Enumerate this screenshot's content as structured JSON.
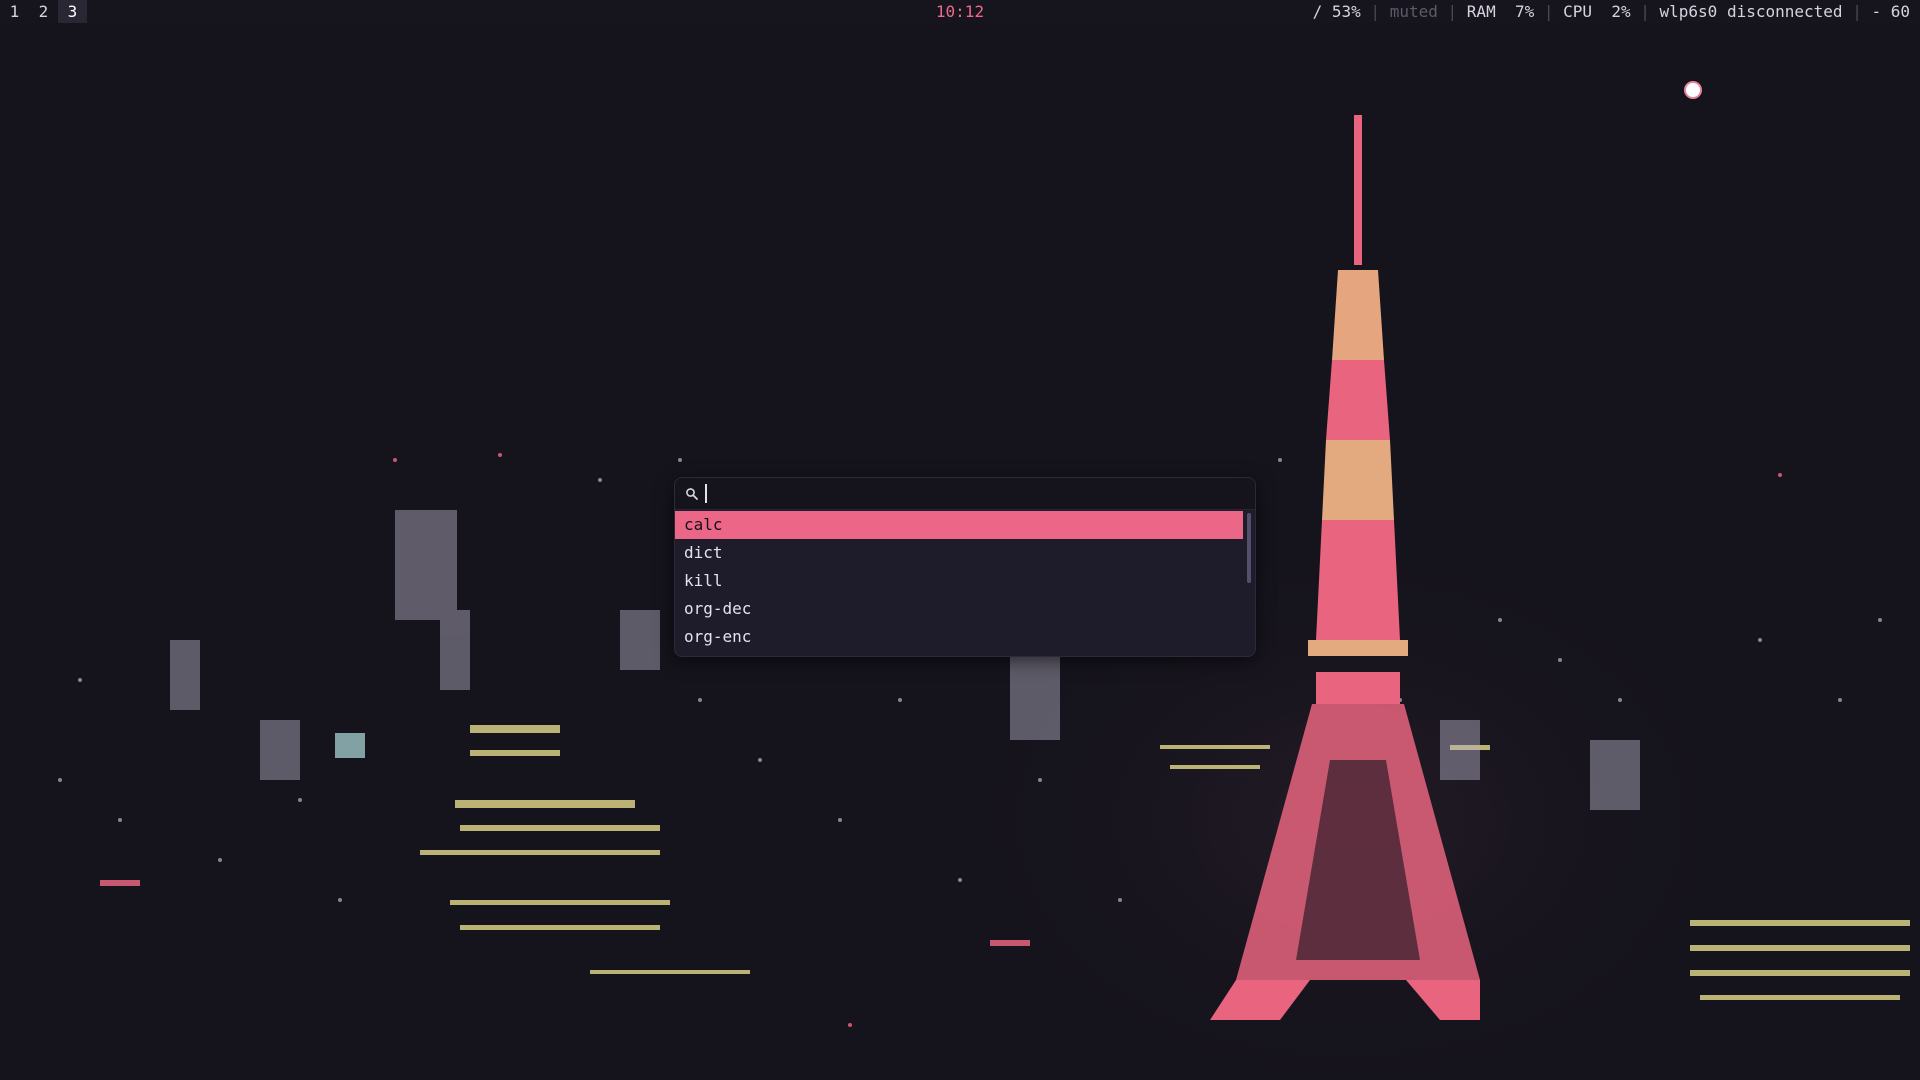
{
  "workspaces": [
    {
      "label": "1",
      "active": false
    },
    {
      "label": "2",
      "active": false
    },
    {
      "label": "3",
      "active": true
    }
  ],
  "clock": "10:12",
  "status": {
    "disk": "/ 53%",
    "volume": "muted",
    "ram_label": "RAM",
    "ram_value": "7%",
    "cpu_label": "CPU",
    "cpu_value": "2%",
    "network": "wlp6s0 disconnected",
    "tail": "- 60",
    "separator": "|"
  },
  "launcher": {
    "search_icon": "search-icon",
    "query": "",
    "results": [
      {
        "label": "calc",
        "selected": true
      },
      {
        "label": "dict",
        "selected": false
      },
      {
        "label": "kill",
        "selected": false
      },
      {
        "label": "org-dec",
        "selected": false
      },
      {
        "label": "org-enc",
        "selected": false
      }
    ]
  },
  "colors": {
    "accent": "#ec6688",
    "bar_bg": "#16141d",
    "desktop_bg": "#15131c",
    "launcher_bg": "#1e1c2a",
    "clock": "#ee6a87",
    "text": "#d8d2e0",
    "muted": "#5e5a68"
  },
  "wallpaper": "Tokyo tower night city"
}
